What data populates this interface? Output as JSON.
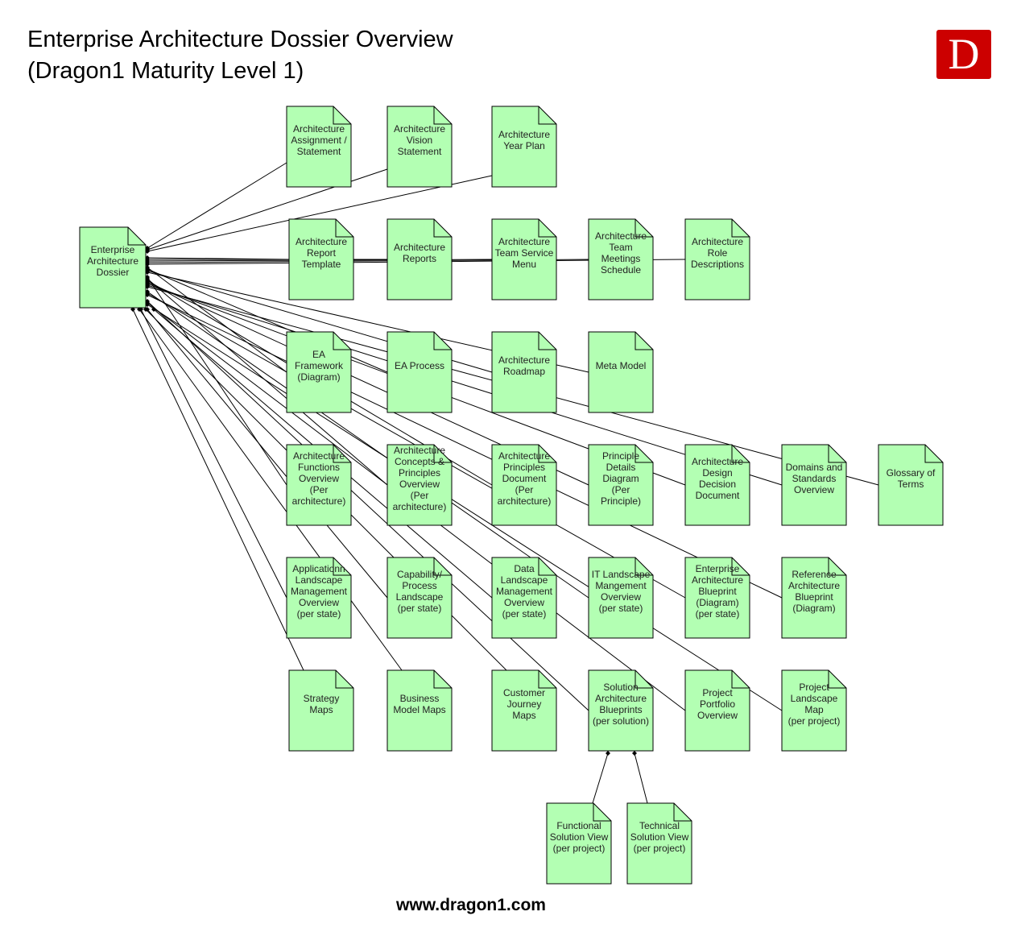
{
  "title_lines": [
    "Enterprise Architecture Dossier Overview",
    "(Dragon1 Maturity Level 1)"
  ],
  "logo_letter": "D",
  "footer": "www.dragon1.com",
  "colors": {
    "doc_fill": "#b3ffb3",
    "doc_stroke": "#000000",
    "logo": "#cc0000"
  },
  "root": {
    "id": "dossier",
    "label": [
      "Enterprise",
      "Architecture",
      "Dossier"
    ]
  },
  "documents": [
    {
      "id": "assignment",
      "label": [
        "Architecture",
        "Assignment /",
        "Statement"
      ],
      "row": 0,
      "col": 0,
      "parent": "dossier"
    },
    {
      "id": "vision",
      "label": [
        "Architecture",
        "Vision",
        "Statement"
      ],
      "row": 0,
      "col": 1,
      "parent": "dossier"
    },
    {
      "id": "year-plan",
      "label": [
        "Architecture",
        "Year Plan"
      ],
      "row": 0,
      "col": 2,
      "parent": "dossier"
    },
    {
      "id": "report-template",
      "label": [
        "Architecture",
        "Report",
        "Template"
      ],
      "row": 1,
      "col": 0,
      "parent": "dossier"
    },
    {
      "id": "reports",
      "label": [
        "Architecture",
        "Reports"
      ],
      "row": 1,
      "col": 1,
      "parent": "dossier"
    },
    {
      "id": "service-menu",
      "label": [
        "Architecture",
        "Team Service",
        "Menu"
      ],
      "row": 1,
      "col": 2,
      "parent": "dossier"
    },
    {
      "id": "meetings",
      "label": [
        "Architecture",
        "Team",
        "Meetings",
        "Schedule"
      ],
      "row": 1,
      "col": 3,
      "parent": "dossier"
    },
    {
      "id": "roles",
      "label": [
        "Architecture",
        "Role",
        "Descriptions"
      ],
      "row": 1,
      "col": 4,
      "parent": "dossier"
    },
    {
      "id": "ea-framework",
      "label": [
        "EA",
        "Framework",
        "(Diagram)"
      ],
      "row": 2,
      "col": 0,
      "parent": "dossier"
    },
    {
      "id": "ea-process",
      "label": [
        "EA Process"
      ],
      "row": 2,
      "col": 1,
      "parent": "dossier"
    },
    {
      "id": "roadmap",
      "label": [
        "Architecture",
        "Roadmap"
      ],
      "row": 2,
      "col": 2,
      "parent": "dossier"
    },
    {
      "id": "meta-model",
      "label": [
        "Meta Model"
      ],
      "row": 2,
      "col": 3,
      "parent": "dossier"
    },
    {
      "id": "functions",
      "label": [
        "Architecture",
        "Functions",
        "Overview",
        "(Per",
        "architecture)"
      ],
      "row": 3,
      "col": 0,
      "parent": "dossier"
    },
    {
      "id": "concepts",
      "label": [
        "Architecture",
        "Concepts &",
        "Principles",
        "Overview",
        "(Per",
        "architecture)"
      ],
      "row": 3,
      "col": 1,
      "parent": "dossier"
    },
    {
      "id": "principles-doc",
      "label": [
        "Architecture",
        "Principles",
        "Document",
        "(Per",
        "architecture)"
      ],
      "row": 3,
      "col": 2,
      "parent": "dossier"
    },
    {
      "id": "principle-details",
      "label": [
        "Principle",
        "Details",
        "Diagram",
        "(Per",
        "Principle)"
      ],
      "row": 3,
      "col": 3,
      "parent": "dossier"
    },
    {
      "id": "design-decision",
      "label": [
        "Architecture",
        "Design",
        "Decision",
        "Document"
      ],
      "row": 3,
      "col": 4,
      "parent": "dossier"
    },
    {
      "id": "domains",
      "label": [
        "Domains and",
        "Standards",
        "Overview"
      ],
      "row": 3,
      "col": 5,
      "parent": "dossier"
    },
    {
      "id": "glossary",
      "label": [
        "Glossary of",
        "Terms"
      ],
      "row": 3,
      "col": 6,
      "parent": "dossier"
    },
    {
      "id": "app-landscape",
      "label": [
        "Applicationn",
        "Landscape",
        "Management",
        "Overview",
        "(per state)"
      ],
      "row": 4,
      "col": 0,
      "parent": "dossier"
    },
    {
      "id": "capability",
      "label": [
        "Capability/",
        "Process",
        "Landscape",
        "(per state)"
      ],
      "row": 4,
      "col": 1,
      "parent": "dossier"
    },
    {
      "id": "data-landscape",
      "label": [
        "Data",
        "Landscape",
        "Management",
        "Overview",
        "(per state)"
      ],
      "row": 4,
      "col": 2,
      "parent": "dossier"
    },
    {
      "id": "it-landscape",
      "label": [
        "IT Landscape",
        "Mangement",
        "Overview",
        "(per state)"
      ],
      "row": 4,
      "col": 3,
      "parent": "dossier"
    },
    {
      "id": "ea-blueprint",
      "label": [
        "Enterprise",
        "Architecture",
        "Blueprint",
        "(Diagram)",
        "(per state)"
      ],
      "row": 4,
      "col": 4,
      "parent": "dossier"
    },
    {
      "id": "ref-blueprint",
      "label": [
        "Reference",
        "Architecture",
        "Blueprint",
        "(Diagram)"
      ],
      "row": 4,
      "col": 5,
      "parent": "dossier"
    },
    {
      "id": "strategy-maps",
      "label": [
        "Strategy",
        "Maps"
      ],
      "row": 5,
      "col": 0,
      "parent": "dossier"
    },
    {
      "id": "business-model",
      "label": [
        "Business",
        "Model Maps"
      ],
      "row": 5,
      "col": 1,
      "parent": "dossier"
    },
    {
      "id": "journey-maps",
      "label": [
        "Customer",
        "Journey",
        "Maps"
      ],
      "row": 5,
      "col": 2,
      "parent": "dossier"
    },
    {
      "id": "solution-blueprints",
      "label": [
        "Solution",
        "Architecture",
        "Blueprints",
        "(per solution)"
      ],
      "row": 5,
      "col": 3,
      "parent": "dossier"
    },
    {
      "id": "portfolio",
      "label": [
        "Project",
        "Portfolio",
        "Overview"
      ],
      "row": 5,
      "col": 4,
      "parent": "dossier"
    },
    {
      "id": "project-landscape",
      "label": [
        "Project",
        "Landscape",
        "Map",
        "(per project)"
      ],
      "row": 5,
      "col": 5,
      "parent": "dossier"
    },
    {
      "id": "functional-view",
      "label": [
        "Functional",
        "Solution View",
        "(per project)"
      ],
      "row": 6,
      "col": 0,
      "parent": "solution-blueprints"
    },
    {
      "id": "technical-view",
      "label": [
        "Technical",
        "Solution View",
        "(per project)"
      ],
      "row": 6,
      "col": 1,
      "parent": "solution-blueprints"
    }
  ]
}
